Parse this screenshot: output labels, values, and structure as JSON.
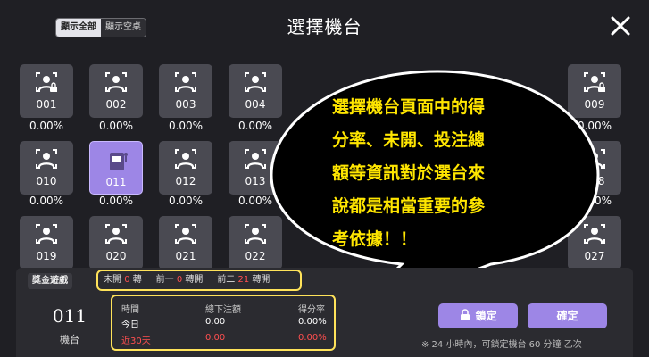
{
  "header": {
    "toggle_all": "顯示全部",
    "toggle_empty": "顯示空桌",
    "title": "選擇機台",
    "close_icon": "close-icon"
  },
  "machines": [
    {
      "id": "001",
      "rate": "0.00%",
      "locked": true
    },
    {
      "id": "002",
      "rate": "0.00%",
      "locked": false
    },
    {
      "id": "003",
      "rate": "0.00%",
      "locked": false
    },
    {
      "id": "004",
      "rate": "0.00%",
      "locked": false
    },
    {
      "id": "009",
      "rate": "0.00%",
      "locked": true
    },
    {
      "id": "010",
      "rate": "0.00%",
      "locked": false
    },
    {
      "id": "011",
      "rate": "0.00%",
      "selected": true
    },
    {
      "id": "012",
      "rate": "0.00%",
      "locked": false
    },
    {
      "id": "013",
      "rate": "0.00%",
      "locked": false
    },
    {
      "id": "018",
      "rate": "0.00%",
      "locked": false
    },
    {
      "id": "019",
      "rate": "",
      "locked": false
    },
    {
      "id": "020",
      "rate": "",
      "locked": false
    },
    {
      "id": "021",
      "rate": "",
      "locked": false
    },
    {
      "id": "022",
      "rate": "",
      "locked": false
    },
    {
      "id": "027",
      "rate": "",
      "locked": false
    }
  ],
  "callout": {
    "lines": [
      "選擇機台頁面中的得",
      "分率、未開、投注總",
      "額等資訊對於選台來",
      "說都是相當重要的參",
      "考依據！！"
    ]
  },
  "bottom": {
    "game_tag": "獎金遊戲",
    "not_open_label": "未開",
    "not_open_value": "0",
    "not_open_unit": "轉",
    "prev1_label": "前一",
    "prev1_value": "0",
    "prev1_unit": "轉開",
    "prev2_label": "前二",
    "prev2_value": "21",
    "prev2_unit": "轉開",
    "machine_number": "011",
    "machine_label": "機台",
    "table": {
      "headers": [
        "時間",
        "總下注額",
        "得分率"
      ],
      "rows": [
        [
          "今日",
          "0.00",
          "0.00%"
        ],
        [
          "近30天",
          "0.00",
          "0.00%"
        ]
      ]
    },
    "lock_button": "鎖定",
    "confirm_button": "確定",
    "note": "※ 24 小時內，可鎖定機台 60 分鐘 乙次"
  },
  "colors": {
    "accent": "#9d86e6",
    "highlight_border": "#ffe35a",
    "callout_fill": "#000000",
    "callout_text": "#ffe600",
    "warning_red": "#ff4f4f"
  }
}
